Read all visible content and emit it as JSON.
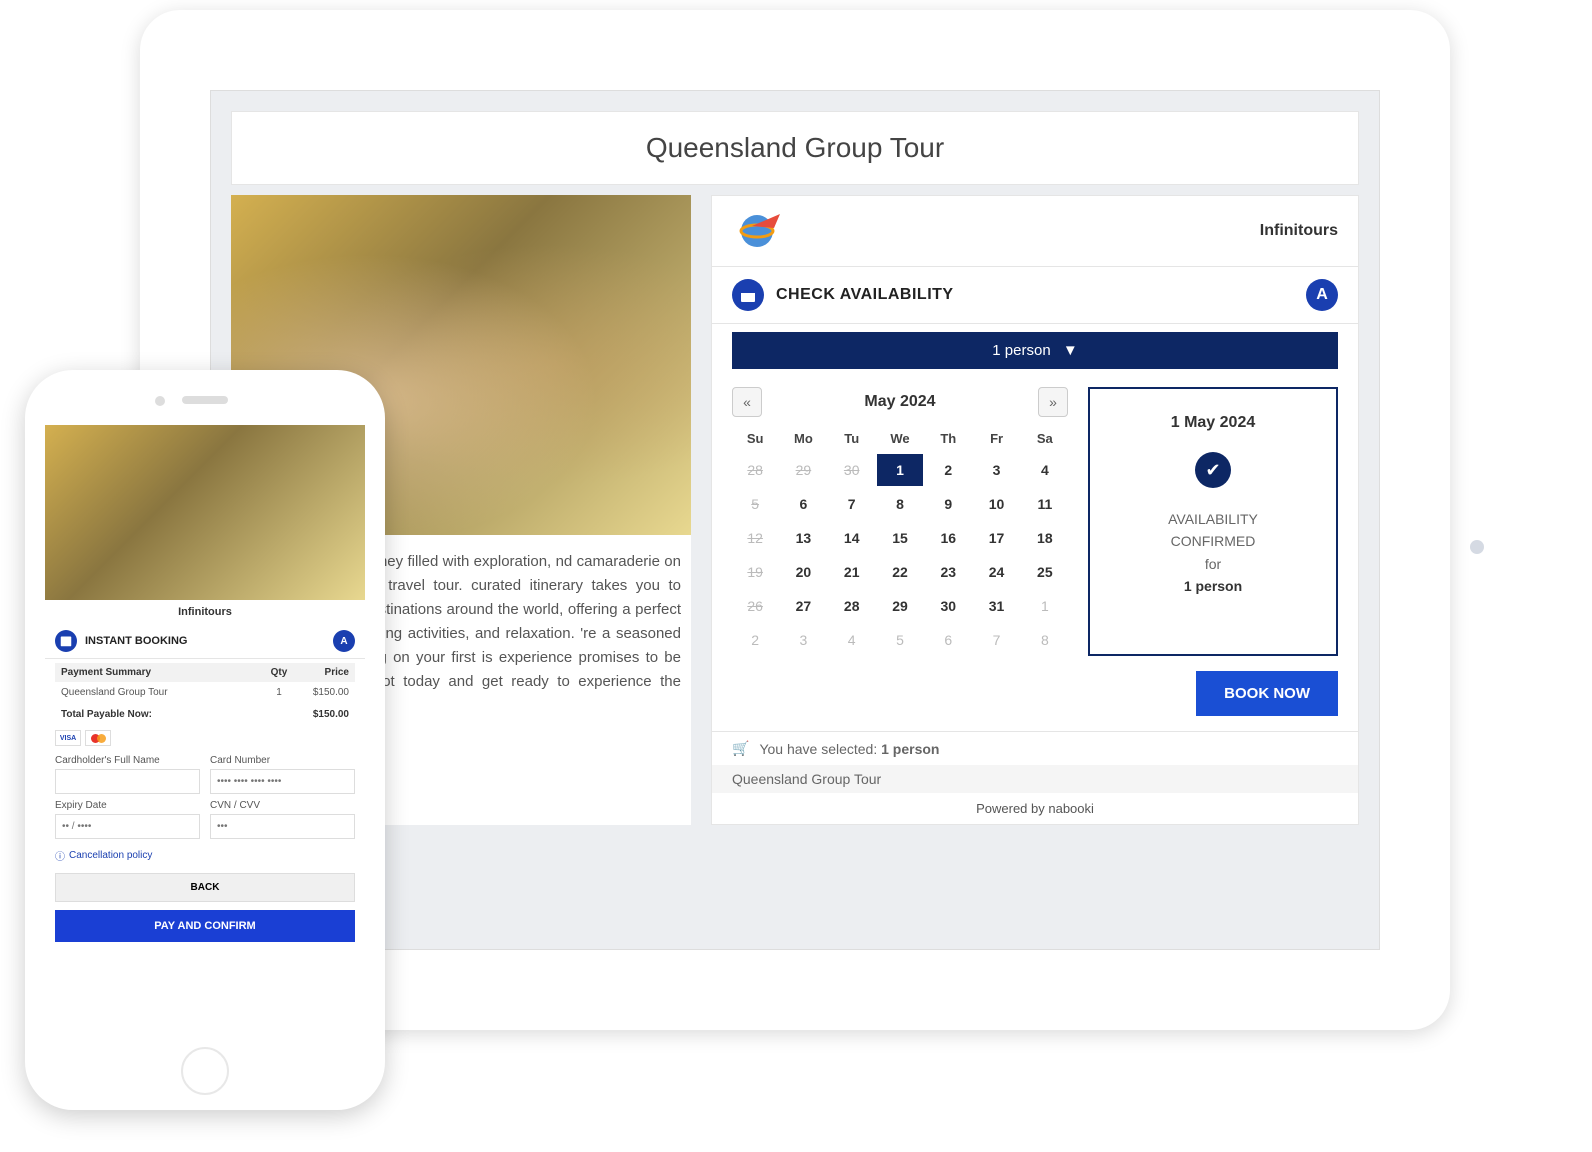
{
  "tablet": {
    "title": "Queensland Group Tour",
    "description": "an unforgettable journey filled with exploration, nd camaraderie on our exclusive group travel tour. curated itinerary takes you to some of the most destinations around the world, offering a perfect tural immersion, thrilling activities, and relaxation. 're a seasoned traveler or embarking on your first is experience promises to be truly exceptional. spot today and get ready to experience the world in way!",
    "brand": "Infinitours",
    "check_availability": "CHECK AVAILABILITY",
    "a_badge": "A",
    "person_selector": "1 person",
    "calendar": {
      "month": "May 2024",
      "prev": "«",
      "next": "»",
      "headers": [
        "Su",
        "Mo",
        "Tu",
        "We",
        "Th",
        "Fr",
        "Sa"
      ],
      "weeks": [
        [
          {
            "d": "28",
            "muted": true
          },
          {
            "d": "29",
            "muted": true
          },
          {
            "d": "30",
            "muted": true
          },
          {
            "d": "1",
            "selected": true
          },
          {
            "d": "2"
          },
          {
            "d": "3"
          },
          {
            "d": "4"
          }
        ],
        [
          {
            "d": "5",
            "muted": true
          },
          {
            "d": "6"
          },
          {
            "d": "7"
          },
          {
            "d": "8"
          },
          {
            "d": "9"
          },
          {
            "d": "10"
          },
          {
            "d": "11"
          }
        ],
        [
          {
            "d": "12",
            "muted": true
          },
          {
            "d": "13"
          },
          {
            "d": "14"
          },
          {
            "d": "15"
          },
          {
            "d": "16"
          },
          {
            "d": "17"
          },
          {
            "d": "18"
          }
        ],
        [
          {
            "d": "19",
            "muted": true
          },
          {
            "d": "20"
          },
          {
            "d": "21"
          },
          {
            "d": "22"
          },
          {
            "d": "23"
          },
          {
            "d": "24"
          },
          {
            "d": "25"
          }
        ],
        [
          {
            "d": "26",
            "muted": true
          },
          {
            "d": "27"
          },
          {
            "d": "28"
          },
          {
            "d": "29"
          },
          {
            "d": "30"
          },
          {
            "d": "31"
          },
          {
            "d": "1",
            "next": true
          }
        ],
        [
          {
            "d": "2",
            "next": true
          },
          {
            "d": "3",
            "next": true
          },
          {
            "d": "4",
            "next": true
          },
          {
            "d": "5",
            "next": true
          },
          {
            "d": "6",
            "next": true
          },
          {
            "d": "7",
            "next": true
          },
          {
            "d": "8",
            "next": true
          }
        ]
      ]
    },
    "confirm": {
      "date": "1 May 2024",
      "line1": "AVAILABILITY",
      "line2": "CONFIRMED",
      "line3": "for",
      "person": "1 person"
    },
    "book_now": "BOOK NOW",
    "selected_prefix": "You have selected: ",
    "selected_value": "1 person",
    "tour_name": "Queensland Group Tour",
    "powered": "Powered by nabooki"
  },
  "phone": {
    "brand": "Infinitours",
    "instant_booking": "INSTANT BOOKING",
    "a_badge": "A",
    "summary": {
      "header": "Payment Summary",
      "qty": "Qty",
      "price": "Price",
      "item": "Queensland Group Tour",
      "item_qty": "1",
      "item_price": "$150.00",
      "total_label": "Total Payable Now:",
      "total": "$150.00"
    },
    "fields": {
      "cardholder": "Cardholder's Full Name",
      "cardholder_ph": " ",
      "cardnumber": "Card Number",
      "cardnumber_ph": "•••• •••• •••• ••••",
      "expiry": "Expiry Date",
      "expiry_ph": "•• / ••••",
      "cvv": "CVN / CVV",
      "cvv_ph": "•••"
    },
    "cancellation": "Cancellation policy",
    "back": "BACK",
    "pay": "PAY AND CONFIRM"
  }
}
